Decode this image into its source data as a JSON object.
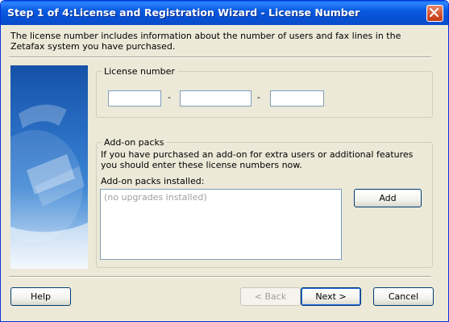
{
  "window": {
    "title": "Step 1 of 4:License and Registration Wizard - License Number"
  },
  "intro_text": "The license number includes information about the number of users and fax lines in the Zetafax system you have purchased.",
  "license": {
    "group_label": "License number",
    "fields": [
      {
        "value": ""
      },
      {
        "value": ""
      },
      {
        "value": ""
      }
    ],
    "separator": "-"
  },
  "addon": {
    "group_label": "Add-on packs",
    "description": "If you have purchased an add-on for extra users or additional features you should enter these license numbers now.",
    "installed_label": "Add-on packs installed:",
    "installed_empty_text": "(no upgrades installed)",
    "add_label": "Add"
  },
  "buttons": {
    "help": "Help",
    "back": "< Back",
    "next": "Next >",
    "cancel": "Cancel"
  },
  "colors": {
    "titlebar": "#0a5be0",
    "dialog_bg": "#ece9d8",
    "close_button": "#d2502c"
  }
}
